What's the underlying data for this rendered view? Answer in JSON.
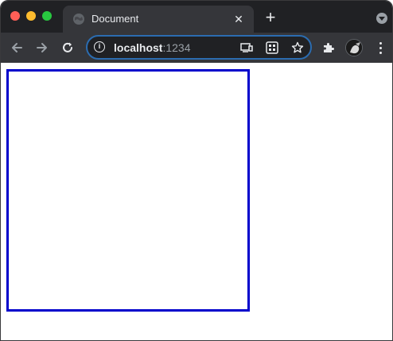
{
  "browser": {
    "tab": {
      "title": "Document",
      "close_glyph": "✕",
      "favicon": "globe-icon"
    },
    "new_tab_glyph": "+",
    "address_bar": {
      "host": "localhost",
      "port": ":1234"
    },
    "colors": {
      "tabstrip": "#202124",
      "toolbar": "#35363a",
      "omnibox_border": "#2b6cb0",
      "box_border": "#0000cc"
    }
  }
}
